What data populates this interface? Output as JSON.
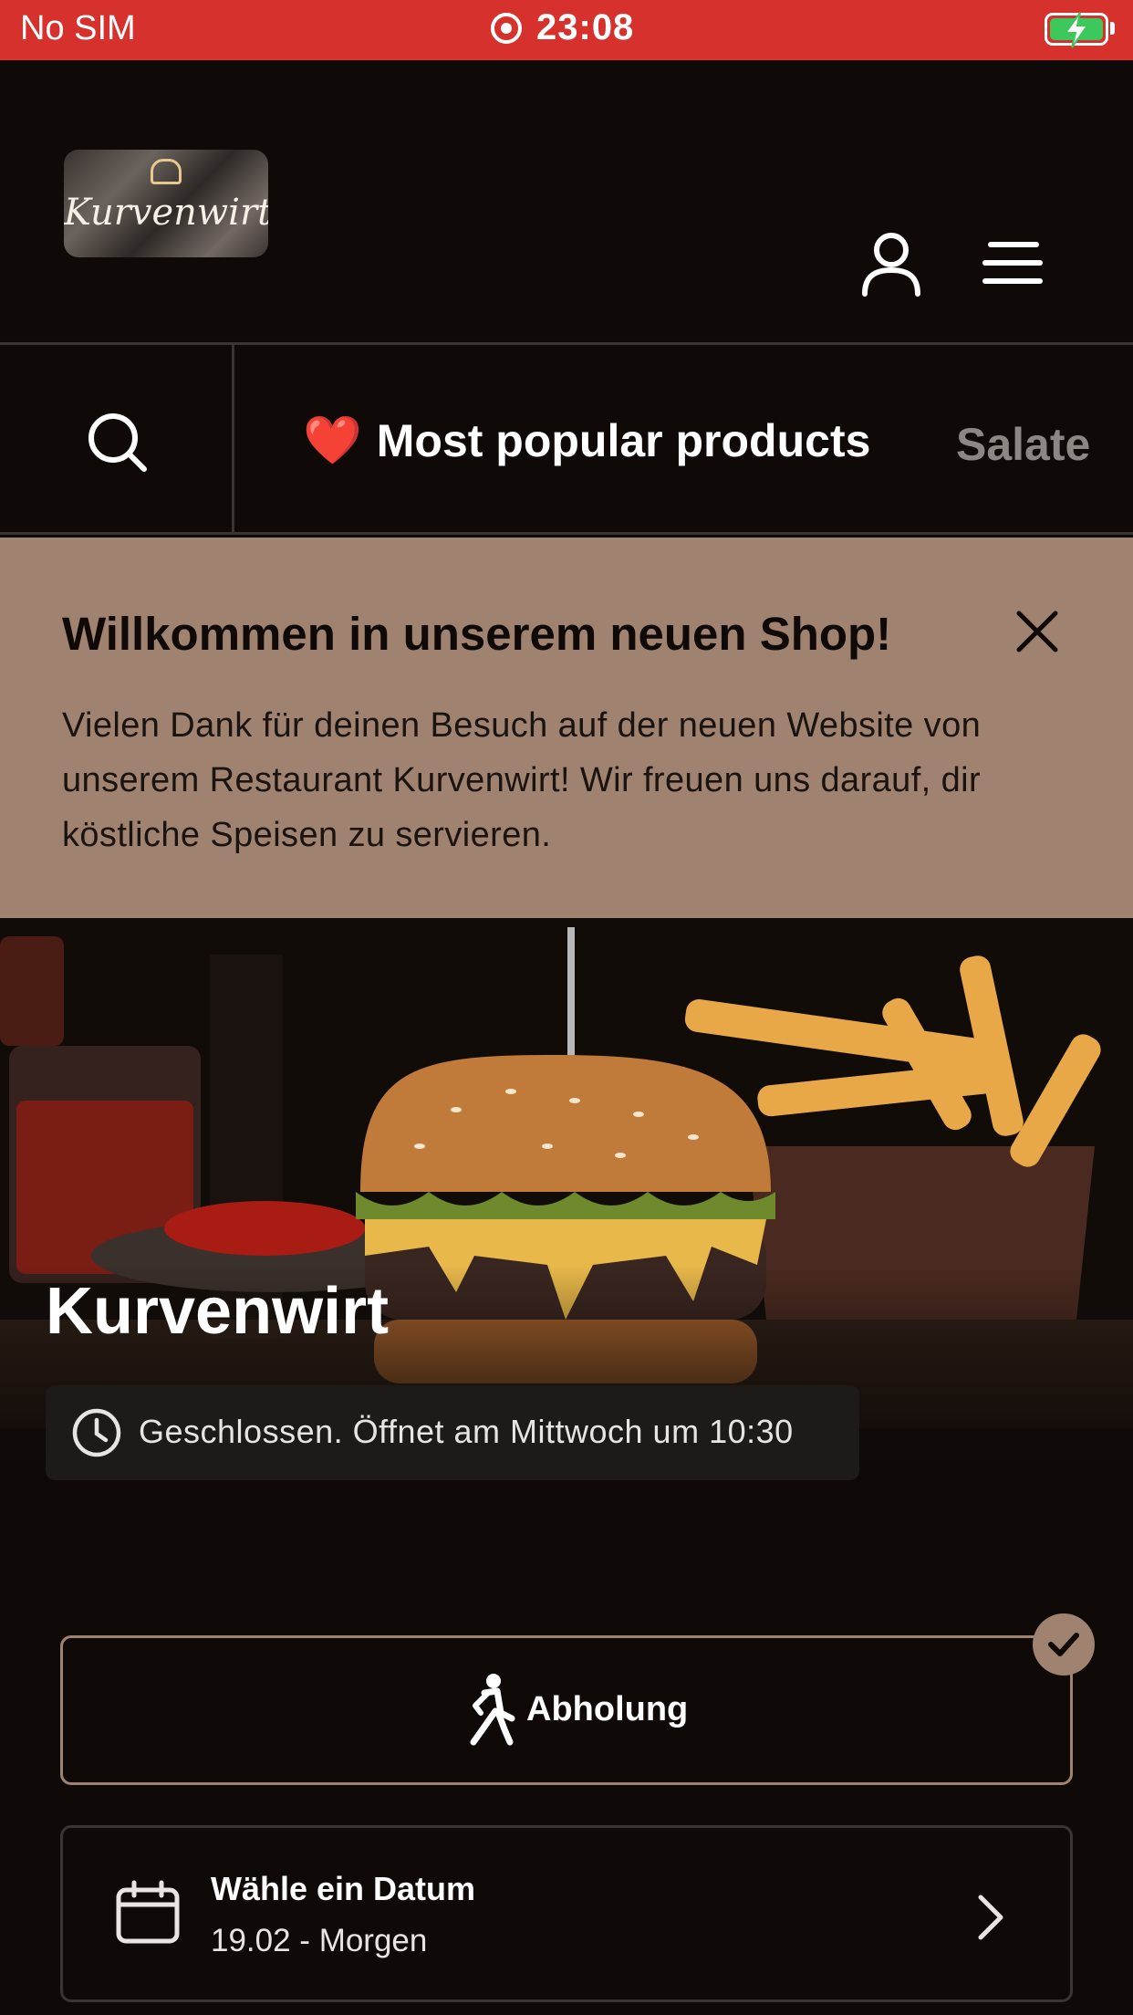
{
  "status_bar": {
    "carrier": "No SIM",
    "time": "23:08",
    "battery": "charging"
  },
  "header": {
    "logo_text": "Kurvenwirt",
    "icons": [
      "user-icon",
      "menu-icon"
    ]
  },
  "categories": {
    "search_icon": "search-icon",
    "active_emoji": "❤️",
    "active_label": "Most popular products",
    "next_label": "Salate"
  },
  "banner": {
    "title": "Willkommen in unserem neuen Shop!",
    "text": "Vielen Dank für deinen Besuch auf der neuen Website von unserem Restaurant Kurvenwirt! Wir freuen uns darauf, dir köstliche Speisen zu servieren.",
    "background": "#a08270"
  },
  "hero": {
    "restaurant_name": "Kurvenwirt",
    "status": "Geschlossen. Öffnet am Mittwoch um 10:30"
  },
  "order_type": {
    "pickup_label": "Abholung",
    "selected": true
  },
  "date_selector": {
    "title": "Wähle ein Datum",
    "value": "19.02 - Morgen"
  },
  "colors": {
    "accent": "#a08270",
    "status_bar": "#d6312d",
    "background": "#0f0a08"
  }
}
